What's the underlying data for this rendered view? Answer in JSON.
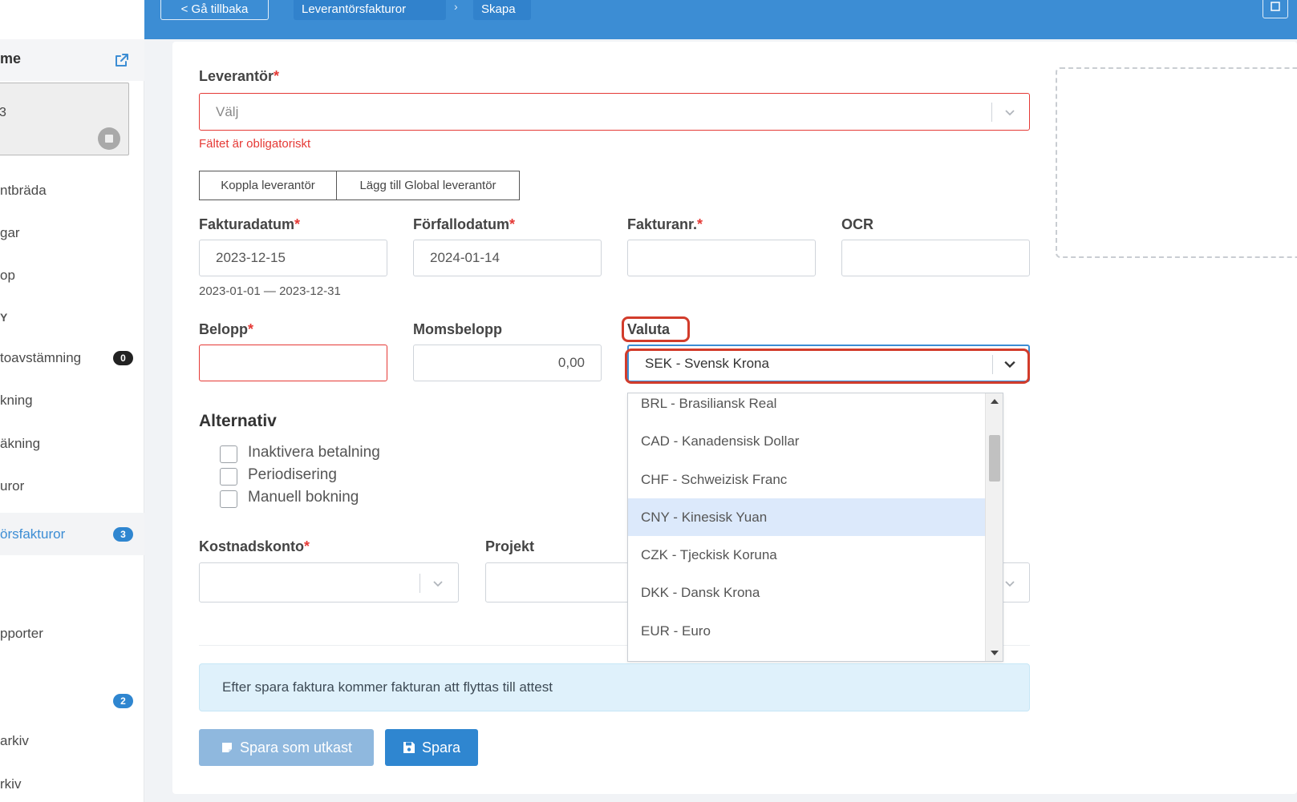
{
  "topbar": {
    "back_label": "< Gå tillbaka",
    "breadcrumb": [
      "Leverantörsfakturor",
      "Skapa"
    ],
    "separator": "›"
  },
  "sidebar": {
    "header_label": "me",
    "company_card_text": "3",
    "items": [
      {
        "label": "ntbräda"
      },
      {
        "label": "gar"
      },
      {
        "label": "op"
      },
      {
        "label": "Y"
      },
      {
        "label": "toavstämning",
        "badge": "0",
        "badge_color": "#222222"
      },
      {
        "label": "kning"
      },
      {
        "label": "äkning"
      },
      {
        "label": "uror"
      },
      {
        "label": "örsfakturor",
        "badge": "3",
        "badge_color": "#2f86d0",
        "active": true
      },
      {
        "label": "pporter"
      },
      {
        "label": "",
        "badge": "2",
        "badge_color": "#2f86d0"
      },
      {
        "label": "arkiv"
      },
      {
        "label": "rkiv"
      }
    ]
  },
  "form": {
    "supplier_label": "Leverantör",
    "required_mark": "*",
    "supplier_placeholder": "Välj",
    "supplier_error": "Fältet är obligatoriskt",
    "link_supplier_btn": "Koppla leverantör",
    "add_global_supplier_btn": "Lägg till Global leverantör",
    "invoice_date_label": "Fakturadatum",
    "invoice_date_value": "2023-12-15",
    "date_range_hint": "2023-01-01 — 2023-12-31",
    "due_date_label": "Förfallodatum",
    "due_date_value": "2024-01-14",
    "invoice_no_label": "Fakturanr.",
    "ocr_label": "OCR",
    "amount_label": "Belopp",
    "vat_label": "Momsbelopp",
    "vat_value": "0,00",
    "currency_label": "Valuta",
    "currency_value": "SEK - Svensk Krona",
    "alternatives_title": "Alternativ",
    "options": [
      "Inaktivera betalning",
      "Periodisering",
      "Manuell bokning"
    ],
    "cost_account_label": "Kostnadskonto",
    "project_label": "Projekt",
    "info_text": "Efter spara faktura kommer fakturan att flyttas till attest",
    "save_draft_btn": "Spara som utkast",
    "save_btn": "Spara"
  },
  "currency_dropdown": {
    "options": [
      "BRL - Brasiliansk Real",
      "CAD - Kanadensisk Dollar",
      "CHF - Schweizisk Franc",
      "CNY - Kinesisk Yuan",
      "CZK - Tjeckisk Koruna",
      "DKK - Dansk Krona",
      "EUR - Euro"
    ],
    "highlighted": "CNY - Kinesisk Yuan"
  },
  "colors": {
    "primary": "#3c8dd4",
    "error": "#e53935",
    "annotation": "#d23c2b",
    "dropdown_highlight": "#dce9fb"
  }
}
